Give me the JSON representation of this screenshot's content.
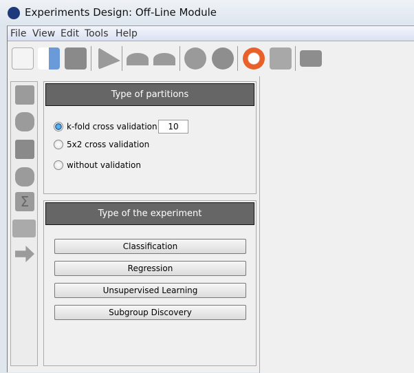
{
  "window": {
    "title": "Experiments Design: Off-Line Module"
  },
  "menu": [
    "File",
    "View",
    "Edit",
    "Tools",
    "Help"
  ],
  "toolbar": [
    "new-document-icon",
    "open-file-icon",
    "save-icon",
    "zip-run-icon",
    "undo-icon",
    "redo-icon",
    "stop-icon",
    "pointer-icon",
    "help-lifebuoy-icon",
    "zoom-graph-icon",
    "chart-icon"
  ],
  "sidebar": [
    "dataset-icon",
    "preprocess-icon",
    "method-icon",
    "postprocess-icon",
    "statistics-icon",
    "visualize-table-icon",
    "connection-arrow-icon"
  ],
  "partitions": {
    "title": "Type of partitions",
    "options": [
      "k-fold cross validation",
      "5x2 cross validation",
      "without validation"
    ],
    "selected": 0,
    "k_value": "10"
  },
  "experiment": {
    "title": "Type of the experiment",
    "buttons": [
      "Classification",
      "Regression",
      "Unsupervised Learning",
      "Subgroup Discovery"
    ]
  }
}
